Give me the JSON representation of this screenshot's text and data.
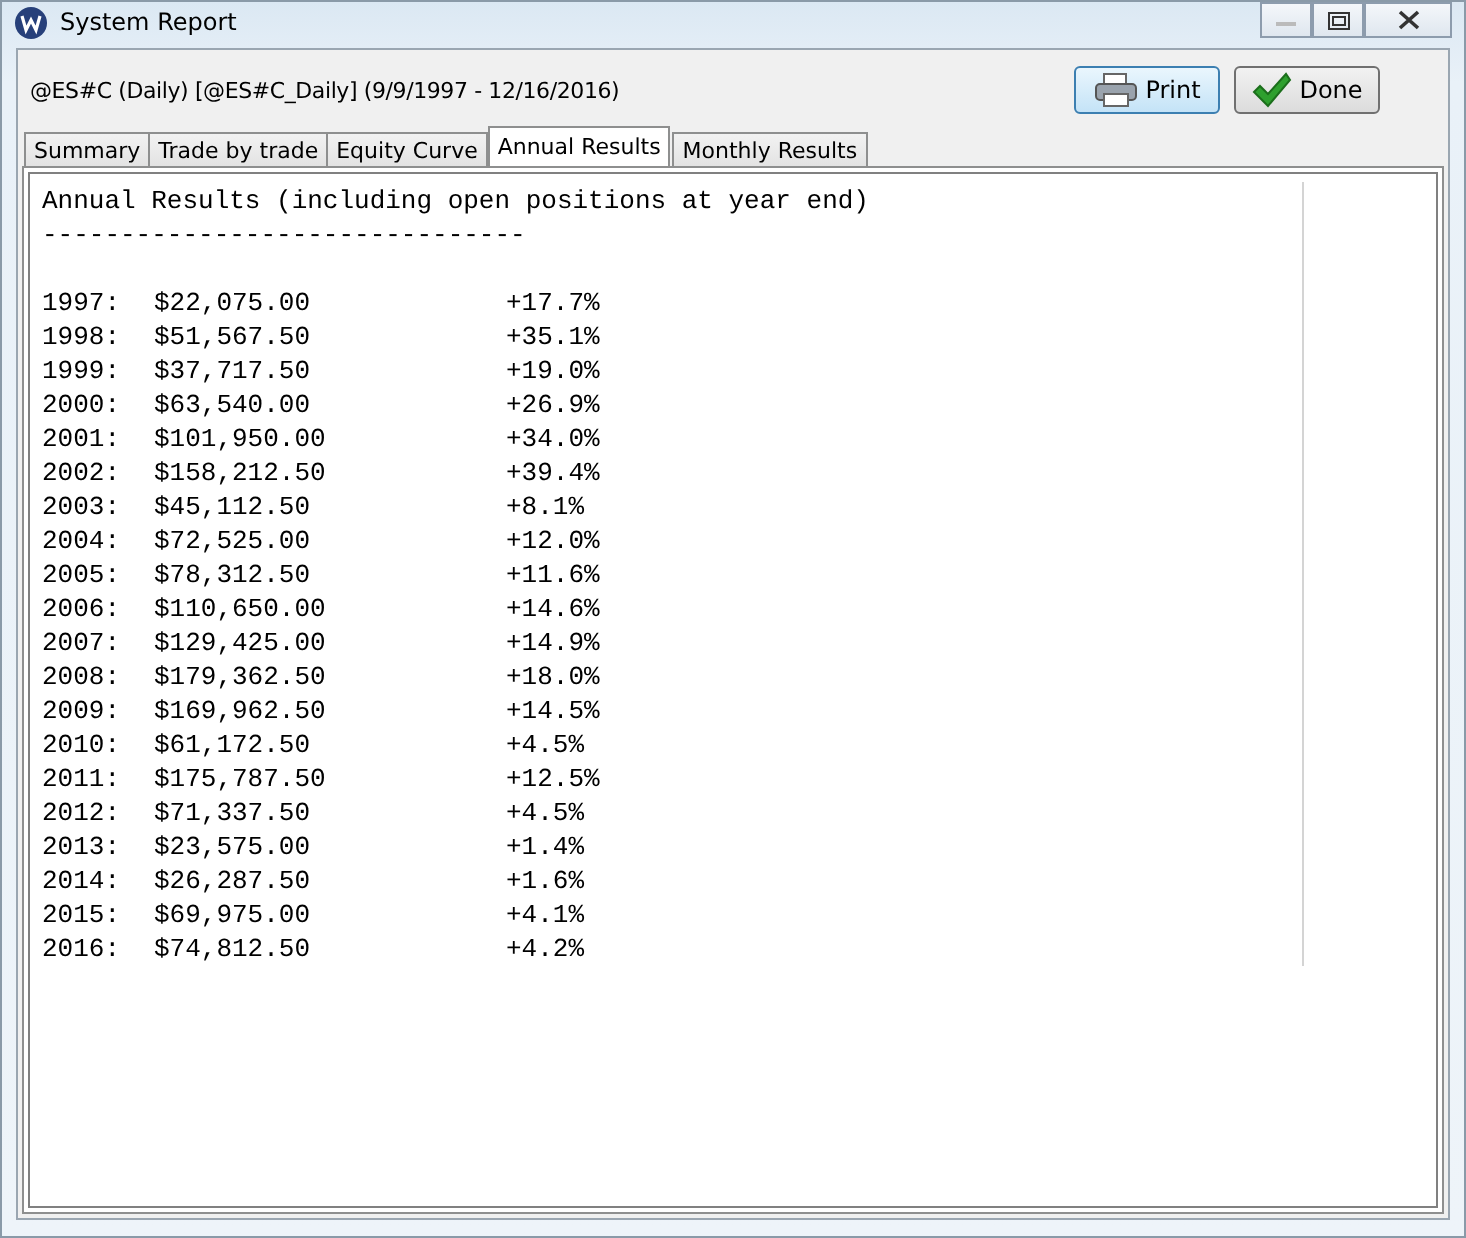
{
  "window": {
    "title": "System Report"
  },
  "header": {
    "symbol": "@ES#C (Daily) [@ES#C_Daily]  (9/9/1997 - 12/16/2016)"
  },
  "buttons": [
    {
      "kind": "print",
      "label": "Print"
    },
    {
      "kind": "done",
      "label": "Done"
    }
  ],
  "tabs": [
    {
      "label": "Summary",
      "selected": false
    },
    {
      "label": "Trade by trade",
      "selected": false
    },
    {
      "label": "Equity Curve",
      "selected": false
    },
    {
      "label": "Annual Results",
      "selected": true
    },
    {
      "label": "Monthly Results",
      "selected": false
    }
  ],
  "report": {
    "title": "Annual Results (including open positions at year end)",
    "rule": "-------------------------------",
    "rows": [
      {
        "year": "1997:",
        "amount": "$22,075.00",
        "change": "+17.7%"
      },
      {
        "year": "1998:",
        "amount": "$51,567.50",
        "change": "+35.1%"
      },
      {
        "year": "1999:",
        "amount": "$37,717.50",
        "change": "+19.0%"
      },
      {
        "year": "2000:",
        "amount": "$63,540.00",
        "change": "+26.9%"
      },
      {
        "year": "2001:",
        "amount": "$101,950.00",
        "change": "+34.0%"
      },
      {
        "year": "2002:",
        "amount": "$158,212.50",
        "change": "+39.4%"
      },
      {
        "year": "2003:",
        "amount": "$45,112.50",
        "change": "+8.1%"
      },
      {
        "year": "2004:",
        "amount": "$72,525.00",
        "change": "+12.0%"
      },
      {
        "year": "2005:",
        "amount": "$78,312.50",
        "change": "+11.6%"
      },
      {
        "year": "2006:",
        "amount": "$110,650.00",
        "change": "+14.6%"
      },
      {
        "year": "2007:",
        "amount": "$129,425.00",
        "change": "+14.9%"
      },
      {
        "year": "2008:",
        "amount": "$179,362.50",
        "change": "+18.0%"
      },
      {
        "year": "2009:",
        "amount": "$169,962.50",
        "change": "+14.5%"
      },
      {
        "year": "2010:",
        "amount": "$61,172.50",
        "change": "+4.5%"
      },
      {
        "year": "2011:",
        "amount": "$175,787.50",
        "change": "+12.5%"
      },
      {
        "year": "2012:",
        "amount": "$71,337.50",
        "change": "+4.5%"
      },
      {
        "year": "2013:",
        "amount": "$23,575.00",
        "change": "+1.4%"
      },
      {
        "year": "2014:",
        "amount": "$26,287.50",
        "change": "+1.6%"
      },
      {
        "year": "2015:",
        "amount": "$69,975.00",
        "change": "+4.1%"
      },
      {
        "year": "2016:",
        "amount": "$74,812.50",
        "change": "+4.2%"
      }
    ]
  }
}
